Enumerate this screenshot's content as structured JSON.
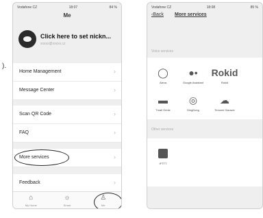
{
  "page_label": ").",
  "left": {
    "status": {
      "carrier": "Vodafone CZ",
      "time": "18:07",
      "battery": "84 %"
    },
    "title": "Me",
    "profile": {
      "name": "Click here to set nickn...",
      "sub": "xxxxx@xxxxx.cz"
    },
    "menu": [
      "Home Management",
      "Message Center",
      "Scan QR Code",
      "FAQ",
      "More services",
      "Feedback"
    ],
    "tabs": [
      {
        "label": "My Home",
        "icon": "home-icon"
      },
      {
        "label": "Smart",
        "icon": "sun-icon"
      },
      {
        "label": "Me",
        "icon": "person-icon"
      }
    ]
  },
  "right": {
    "status": {
      "carrier": "Vodafone CZ",
      "time": "18:08",
      "battery": "85 %"
    },
    "back_label": "Back",
    "title": "More services",
    "voice_section": "Voice services",
    "services": [
      {
        "name": "Alexa",
        "icon": "alexa-icon"
      },
      {
        "name": "Google Assistant",
        "icon": "google-assistant-icon"
      },
      {
        "name": "Rokid",
        "icon": "rokid-icon"
      },
      {
        "name": "Tmall Genie",
        "icon": "tmall-icon"
      },
      {
        "name": "DingDong",
        "icon": "dingdong-icon"
      },
      {
        "name": "Tencent Xiaowei",
        "icon": "tencent-icon"
      }
    ],
    "other_section": "Other services",
    "other_services": [
      {
        "name": "IFTTT",
        "icon": "ifttt-icon"
      }
    ]
  }
}
